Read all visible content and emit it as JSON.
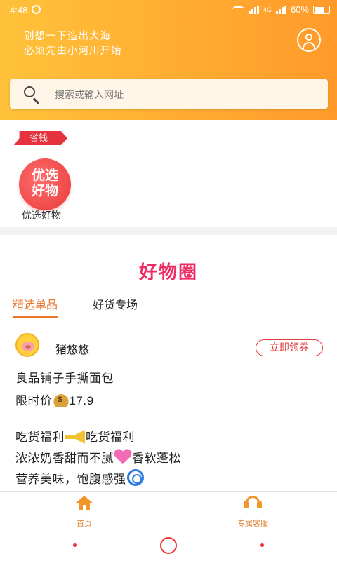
{
  "status_bar": {
    "time": "4:48",
    "network": "4G",
    "battery": "60%",
    "battery_level": 0.6
  },
  "header": {
    "slogan_line1": "别想一下造出大海",
    "slogan_line2": "必须先由小河川开始",
    "profile_icon": "user-icon"
  },
  "search": {
    "placeholder": "搜索或输入网址",
    "icon": "search-icon"
  },
  "save_section": {
    "tag": "省钱",
    "item_badge_line1": "优选",
    "item_badge_line2": "好物",
    "item_label": "优选好物"
  },
  "circle": {
    "title": "好物圈",
    "tabs": [
      "精选单品",
      "好货专场"
    ],
    "active_tab": "精选单品",
    "post": {
      "user": "猪悠悠",
      "claim_button": "立即领券",
      "product": "良品铺子手撕面包",
      "price_label": "限时价",
      "price": "17.9",
      "desc1_a": "吃货福利",
      "desc1_b": "吃货福利",
      "desc2_a": "浓浓奶香甜而不腻",
      "desc2_b": "香软蓬松",
      "desc3": "营养美味，饱腹感强"
    }
  },
  "bottom_nav": {
    "home": "首页",
    "service": "专属客服",
    "colors": {
      "accent": "#e07f2a"
    }
  },
  "colors": {
    "header_start": "#ffc23a",
    "header_end": "#ff9a2a",
    "title_pink": "#f02c64",
    "tab_active": "#e8742a",
    "claim_red": "#e43b3b"
  }
}
